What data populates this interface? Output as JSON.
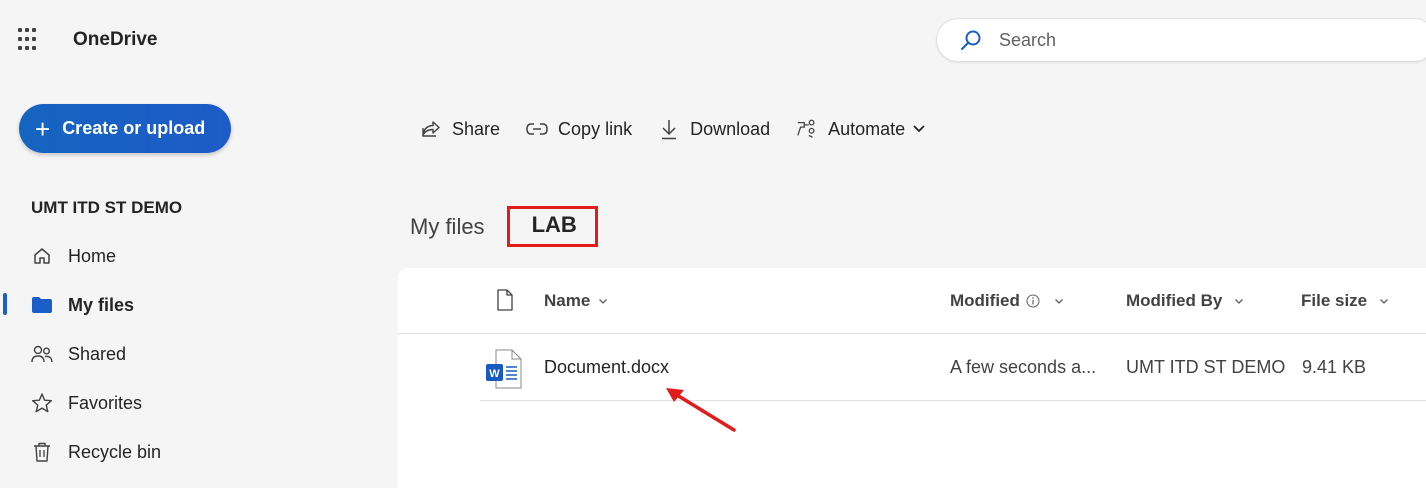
{
  "app": {
    "title": "OneDrive"
  },
  "search": {
    "placeholder": "Search"
  },
  "sidebar": {
    "create_label": "Create or upload",
    "org_name": "UMT ITD ST DEMO",
    "items": [
      {
        "label": "Home",
        "icon": "home-icon"
      },
      {
        "label": "My files",
        "icon": "folder-icon",
        "active": true
      },
      {
        "label": "Shared",
        "icon": "people-icon"
      },
      {
        "label": "Favorites",
        "icon": "star-icon"
      },
      {
        "label": "Recycle bin",
        "icon": "trash-icon"
      }
    ]
  },
  "toolbar": {
    "share": "Share",
    "copy_link": "Copy link",
    "download": "Download",
    "automate": "Automate"
  },
  "breadcrumb": {
    "root": "My files",
    "current": "LAB"
  },
  "table": {
    "columns": {
      "name": "Name",
      "modified": "Modified",
      "modified_by": "Modified By",
      "file_size": "File size"
    },
    "rows": [
      {
        "name": "Document.docx",
        "modified": "A few seconds a...",
        "modified_by": "UMT ITD ST DEMO",
        "file_size": "9.41 KB"
      }
    ]
  },
  "colors": {
    "accent": "#1b5ec7",
    "highlight": "#e21b1b",
    "word": "#185abd"
  }
}
